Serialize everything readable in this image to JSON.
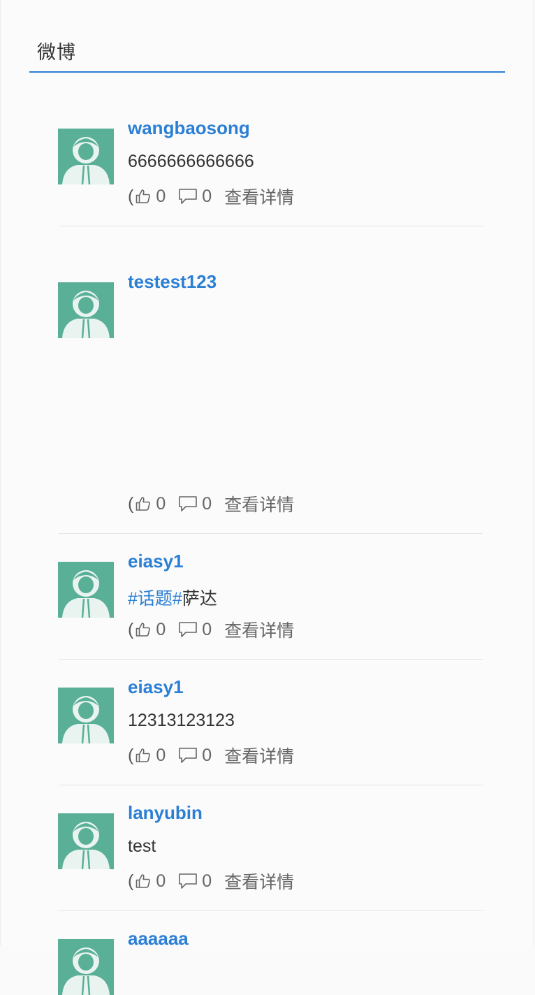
{
  "header": {
    "title": "微博"
  },
  "posts": [
    {
      "username": "wangbaosong",
      "content": "6666666666666",
      "likes": "0",
      "comments": "0",
      "detail_label": "查看详情"
    },
    {
      "username": "testest123",
      "content": "",
      "likes": "0",
      "comments": "0",
      "detail_label": "查看详情"
    },
    {
      "username": "eiasy1",
      "topic": "#话题#",
      "content": "萨达",
      "likes": "0",
      "comments": "0",
      "detail_label": "查看详情"
    },
    {
      "username": "eiasy1",
      "content": "12313123123",
      "likes": "0",
      "comments": "0",
      "detail_label": "查看详情"
    },
    {
      "username": "lanyubin",
      "content": "test",
      "likes": "0",
      "comments": "0",
      "detail_label": "查看详情"
    },
    {
      "username": "aaaaaa",
      "content": "",
      "likes": "",
      "comments": "",
      "detail_label": ""
    }
  ],
  "colors": {
    "accent": "#2b7fd4",
    "avatar_bg": "#5aaf97"
  },
  "icons": {
    "like": "thumbs-up-icon",
    "comment": "comment-bubble-icon",
    "avatar": "default-user-avatar-icon"
  }
}
